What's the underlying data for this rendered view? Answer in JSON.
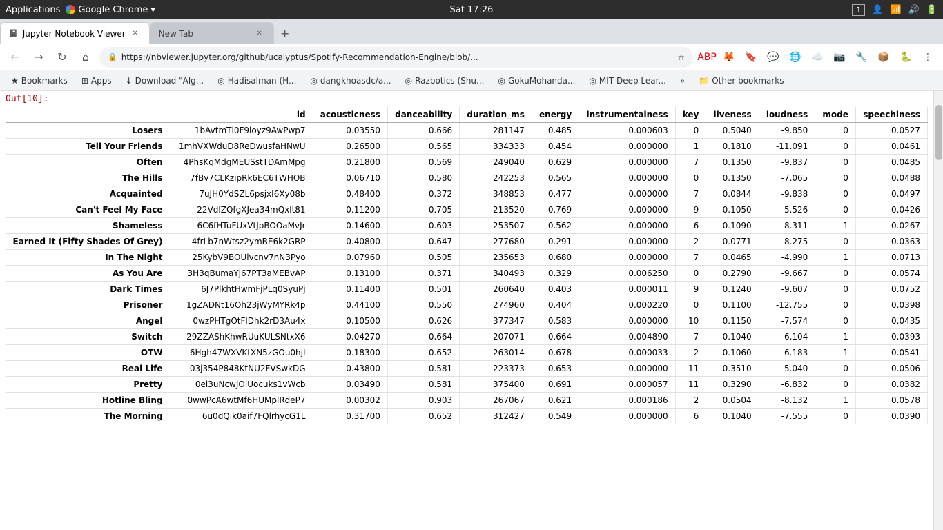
{
  "taskbar": {
    "apps_label": "Applications",
    "chrome_label": "Google Chrome",
    "time": "Sat 17:26",
    "window_num": "1"
  },
  "tabs": [
    {
      "id": "jupyter-tab",
      "label": "Jupyter Notebook Viewer",
      "active": true,
      "favicon": "📓",
      "closeable": true
    },
    {
      "id": "new-tab",
      "label": "New Tab",
      "active": false,
      "favicon": "",
      "closeable": true
    }
  ],
  "address_bar": {
    "url": "https://nbviewer.jupyter.org/github/ucalyptus/Spotify-Recommendation-Engine/blob/..."
  },
  "bookmarks": [
    {
      "label": "Bookmarks",
      "icon": "★"
    },
    {
      "label": "Apps",
      "icon": "⊞"
    },
    {
      "label": "Download \"Alg...",
      "icon": "↓"
    },
    {
      "label": "Hadisalman (H...",
      "icon": "◎"
    },
    {
      "label": "dangkhoasdc/a...",
      "icon": "◎"
    },
    {
      "label": "Razbotics (Shu...",
      "icon": "◎"
    },
    {
      "label": "GokuMohanda...",
      "icon": "◎"
    },
    {
      "label": "MIT Deep Lear...",
      "icon": "◎"
    },
    {
      "label": "»",
      "icon": ""
    },
    {
      "label": "Other bookmarks",
      "icon": "📁"
    }
  ],
  "out_label": "Out[10]:",
  "table": {
    "columns": [
      "id",
      "acousticness",
      "danceability",
      "duration_ms",
      "energy",
      "instrumentalness",
      "key",
      "liveness",
      "loudness",
      "mode",
      "speechiness"
    ],
    "rows": [
      {
        "name": "Losers",
        "id": "1bAvtmTl0F9loyz9AwPwp7",
        "acousticness": "0.03550",
        "danceability": "0.666",
        "duration_ms": "281147",
        "energy": "0.485",
        "instrumentalness": "0.000603",
        "key": "0",
        "liveness": "0.5040",
        "loudness": "-9.850",
        "mode": "0",
        "speechiness": "0.0527"
      },
      {
        "name": "Tell Your Friends",
        "id": "1mhVXWduD8ReDwusfaHNwU",
        "acousticness": "0.26500",
        "danceability": "0.565",
        "duration_ms": "334333",
        "energy": "0.454",
        "instrumentalness": "0.000000",
        "key": "1",
        "liveness": "0.1810",
        "loudness": "-11.091",
        "mode": "0",
        "speechiness": "0.0461"
      },
      {
        "name": "Often",
        "id": "4PhsKqMdgMEUSstTDAmMpg",
        "acousticness": "0.21800",
        "danceability": "0.569",
        "duration_ms": "249040",
        "energy": "0.629",
        "instrumentalness": "0.000000",
        "key": "7",
        "liveness": "0.1350",
        "loudness": "-9.837",
        "mode": "0",
        "speechiness": "0.0485"
      },
      {
        "name": "The Hills",
        "id": "7fBv7CLKzipRk6EC6TWHOB",
        "acousticness": "0.06710",
        "danceability": "0.580",
        "duration_ms": "242253",
        "energy": "0.565",
        "instrumentalness": "0.000000",
        "key": "0",
        "liveness": "0.1350",
        "loudness": "-7.065",
        "mode": "0",
        "speechiness": "0.0488"
      },
      {
        "name": "Acquainted",
        "id": "7uJH0YdSZL6psjxI6Xy08b",
        "acousticness": "0.48400",
        "danceability": "0.372",
        "duration_ms": "348853",
        "energy": "0.477",
        "instrumentalness": "0.000000",
        "key": "7",
        "liveness": "0.0844",
        "loudness": "-9.838",
        "mode": "0",
        "speechiness": "0.0497"
      },
      {
        "name": "Can't Feel My Face",
        "id": "22VdlZQfgXJea34mQxlt81",
        "acousticness": "0.11200",
        "danceability": "0.705",
        "duration_ms": "213520",
        "energy": "0.769",
        "instrumentalness": "0.000000",
        "key": "9",
        "liveness": "0.1050",
        "loudness": "-5.526",
        "mode": "0",
        "speechiness": "0.0426"
      },
      {
        "name": "Shameless",
        "id": "6C6fHTuFUxVtJpBOOaMvJr",
        "acousticness": "0.14600",
        "danceability": "0.603",
        "duration_ms": "253507",
        "energy": "0.562",
        "instrumentalness": "0.000000",
        "key": "6",
        "liveness": "0.1090",
        "loudness": "-8.311",
        "mode": "1",
        "speechiness": "0.0267"
      },
      {
        "name": "Earned It (Fifty Shades Of Grey)",
        "id": "4frLb7nWtsz2ymBE6k2GRP",
        "acousticness": "0.40800",
        "danceability": "0.647",
        "duration_ms": "277680",
        "energy": "0.291",
        "instrumentalness": "0.000000",
        "key": "2",
        "liveness": "0.0771",
        "loudness": "-8.275",
        "mode": "0",
        "speechiness": "0.0363"
      },
      {
        "name": "In The Night",
        "id": "25KybV9BOUlvcnv7nN3Pyo",
        "acousticness": "0.07960",
        "danceability": "0.505",
        "duration_ms": "235653",
        "energy": "0.680",
        "instrumentalness": "0.000000",
        "key": "7",
        "liveness": "0.0465",
        "loudness": "-4.990",
        "mode": "1",
        "speechiness": "0.0713"
      },
      {
        "name": "As You Are",
        "id": "3H3qBumaYj67PT3aMEBvAP",
        "acousticness": "0.13100",
        "danceability": "0.371",
        "duration_ms": "340493",
        "energy": "0.329",
        "instrumentalness": "0.006250",
        "key": "0",
        "liveness": "0.2790",
        "loudness": "-9.667",
        "mode": "0",
        "speechiness": "0.0574"
      },
      {
        "name": "Dark Times",
        "id": "6J7PlkhtHwmFjPLq0SyuPj",
        "acousticness": "0.11400",
        "danceability": "0.501",
        "duration_ms": "260640",
        "energy": "0.403",
        "instrumentalness": "0.000011",
        "key": "9",
        "liveness": "0.1240",
        "loudness": "-9.607",
        "mode": "0",
        "speechiness": "0.0752"
      },
      {
        "name": "Prisoner",
        "id": "1gZADNt16Oh23jWyMYRk4p",
        "acousticness": "0.44100",
        "danceability": "0.550",
        "duration_ms": "274960",
        "energy": "0.404",
        "instrumentalness": "0.000220",
        "key": "0",
        "liveness": "0.1100",
        "loudness": "-12.755",
        "mode": "0",
        "speechiness": "0.0398"
      },
      {
        "name": "Angel",
        "id": "0wzPHTgOtFlDhk2rD3Au4x",
        "acousticness": "0.10500",
        "danceability": "0.626",
        "duration_ms": "377347",
        "energy": "0.583",
        "instrumentalness": "0.000000",
        "key": "10",
        "liveness": "0.1150",
        "loudness": "-7.574",
        "mode": "0",
        "speechiness": "0.0435"
      },
      {
        "name": "Switch",
        "id": "29ZZAShKhwRUuKULSNtxX6",
        "acousticness": "0.04270",
        "danceability": "0.664",
        "duration_ms": "207071",
        "energy": "0.664",
        "instrumentalness": "0.004890",
        "key": "7",
        "liveness": "0.1040",
        "loudness": "-6.104",
        "mode": "1",
        "speechiness": "0.0393"
      },
      {
        "name": "OTW",
        "id": "6Hgh47WXVKtXN5zGOu0hjI",
        "acousticness": "0.18300",
        "danceability": "0.652",
        "duration_ms": "263014",
        "energy": "0.678",
        "instrumentalness": "0.000033",
        "key": "2",
        "liveness": "0.1060",
        "loudness": "-6.183",
        "mode": "1",
        "speechiness": "0.0541"
      },
      {
        "name": "Real Life",
        "id": "03j354P848KtNU2FVSwkDG",
        "acousticness": "0.43800",
        "danceability": "0.581",
        "duration_ms": "223373",
        "energy": "0.653",
        "instrumentalness": "0.000000",
        "key": "11",
        "liveness": "0.3510",
        "loudness": "-5.040",
        "mode": "0",
        "speechiness": "0.0506"
      },
      {
        "name": "Pretty",
        "id": "0ei3uNcwJOiUocuks1vWcb",
        "acousticness": "0.03490",
        "danceability": "0.581",
        "duration_ms": "375400",
        "energy": "0.691",
        "instrumentalness": "0.000057",
        "key": "11",
        "liveness": "0.3290",
        "loudness": "-6.832",
        "mode": "0",
        "speechiness": "0.0382"
      },
      {
        "name": "Hotline Bling",
        "id": "0wwPcA6wtMf6HUMplRdeP7",
        "acousticness": "0.00302",
        "danceability": "0.903",
        "duration_ms": "267067",
        "energy": "0.621",
        "instrumentalness": "0.000186",
        "key": "2",
        "liveness": "0.0504",
        "loudness": "-8.132",
        "mode": "1",
        "speechiness": "0.0578"
      },
      {
        "name": "The Morning",
        "id": "6u0dQik0aif7FQlrhycG1L",
        "acousticness": "0.31700",
        "danceability": "0.652",
        "duration_ms": "312427",
        "energy": "0.549",
        "instrumentalness": "0.000000",
        "key": "6",
        "liveness": "0.1040",
        "loudness": "-7.555",
        "mode": "0",
        "speechiness": "0.0390"
      }
    ]
  }
}
